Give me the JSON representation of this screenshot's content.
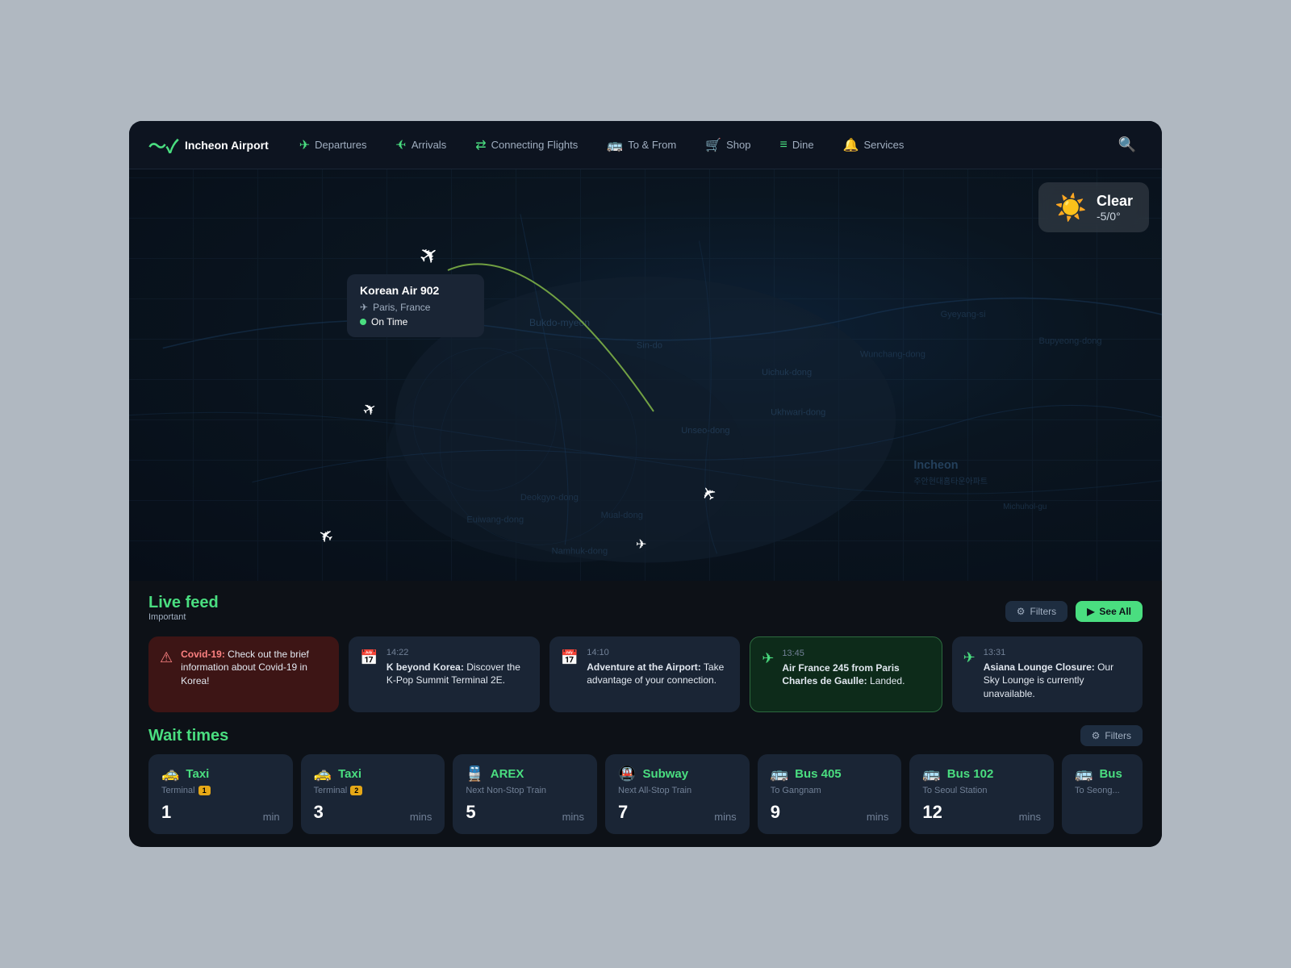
{
  "app": {
    "title": "Incheon Airport"
  },
  "navbar": {
    "logo_text": "Incheon Airport",
    "items": [
      {
        "id": "departures",
        "label": "Departures",
        "icon": "✈"
      },
      {
        "id": "arrivals",
        "label": "Arrivals",
        "icon": "✈"
      },
      {
        "id": "connecting-flights",
        "label": "Connecting Flights",
        "icon": "⇄"
      },
      {
        "id": "to-from",
        "label": "To & From",
        "icon": "🚌"
      },
      {
        "id": "shop",
        "label": "Shop",
        "icon": "🛒"
      },
      {
        "id": "dine",
        "label": "Dine",
        "icon": "🍽"
      },
      {
        "id": "services",
        "label": "Services",
        "icon": "🔔"
      }
    ]
  },
  "weather": {
    "condition": "Clear",
    "temperature": "-5/0°"
  },
  "flight_tooltip": {
    "name": "Korean Air 902",
    "destination": "Paris, France",
    "status": "On Time"
  },
  "live_feed": {
    "title": "Live feed",
    "subtitle": "Important",
    "filters_label": "Filters",
    "see_all_label": "See All",
    "cards": [
      {
        "id": "covid",
        "type": "red",
        "time": "",
        "icon": "⚠",
        "text_highlight": "Covid-19:",
        "text": " Check out the brief information about Covid-19 in Korea!"
      },
      {
        "id": "k-beyond",
        "type": "normal",
        "time": "14:22",
        "icon": "📅",
        "text_bold": "K beyond Korea:",
        "text": " Discover the K-Pop Summit Terminal 2E."
      },
      {
        "id": "adventure",
        "type": "normal",
        "time": "14:10",
        "icon": "📅",
        "text_bold": "Adventure at the Airport:",
        "text": " Take advantage of your connection."
      },
      {
        "id": "air-france",
        "type": "green",
        "time": "13:45",
        "icon": "✈",
        "text_bold": "Air France 245 from Paris Charles de Gaulle:",
        "text": " Landed."
      },
      {
        "id": "asiana",
        "type": "normal",
        "time": "13:31",
        "icon": "🚫",
        "text_bold": "Asiana Lounge Closure:",
        "text": " Our Sky Lounge is currently unavailable."
      }
    ]
  },
  "wait_times": {
    "title": "Wait times",
    "filters_label": "Filters",
    "cards": [
      {
        "id": "taxi-1",
        "icon": "🚕",
        "name": "Taxi",
        "sub": "Terminal",
        "terminal_badge": "1",
        "time": "1",
        "unit": "min"
      },
      {
        "id": "taxi-2",
        "icon": "🚕",
        "name": "Taxi",
        "sub": "Terminal",
        "terminal_badge": "2",
        "time": "3",
        "unit": "mins"
      },
      {
        "id": "arex",
        "icon": "🚆",
        "name": "AREX",
        "sub": "Next Non-Stop Train",
        "terminal_badge": "",
        "time": "5",
        "unit": "mins"
      },
      {
        "id": "subway",
        "icon": "🚇",
        "name": "Subway",
        "sub": "Next All-Stop Train",
        "terminal_badge": "",
        "time": "7",
        "unit": "mins"
      },
      {
        "id": "bus-405",
        "icon": "🚌",
        "name": "Bus 405",
        "sub": "To Gangnam",
        "terminal_badge": "",
        "time": "9",
        "unit": "mins"
      },
      {
        "id": "bus-102",
        "icon": "🚌",
        "name": "Bus 102",
        "sub": "To Seoul Station",
        "terminal_badge": "",
        "time": "12",
        "unit": "mins"
      },
      {
        "id": "bus-seong",
        "icon": "🚌",
        "name": "Bus",
        "sub": "To Seongnam",
        "terminal_badge": "",
        "time": "",
        "unit": ""
      }
    ]
  }
}
